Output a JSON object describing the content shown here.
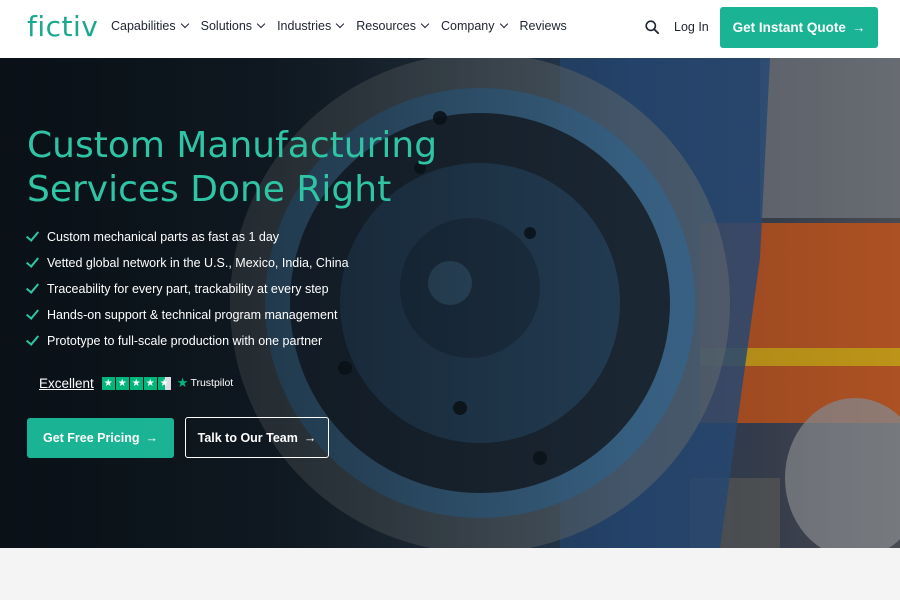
{
  "brand": {
    "logo_text": "fictiv",
    "accent_color": "#1ab394",
    "headline_color": "#2ec4a4"
  },
  "nav": {
    "items": [
      {
        "label": "Capabilities",
        "has_dropdown": true
      },
      {
        "label": "Solutions",
        "has_dropdown": true
      },
      {
        "label": "Industries",
        "has_dropdown": true
      },
      {
        "label": "Resources",
        "has_dropdown": true
      },
      {
        "label": "Company",
        "has_dropdown": true
      },
      {
        "label": "Reviews",
        "has_dropdown": false
      }
    ],
    "search_icon": "search-icon",
    "login_label": "Log In",
    "quote_label": "Get Instant Quote",
    "quote_arrow": "→"
  },
  "hero": {
    "headline_line1": "Custom Manufacturing",
    "headline_line2": "Services Done Right",
    "bullets": [
      "Custom mechanical parts as fast as 1 day",
      "Vetted global network in the U.S., Mexico, India, China",
      "Traceability for every part, trackability at every step",
      "Hands-on support & technical program management",
      "Prototype to full-scale production with one partner"
    ],
    "trust": {
      "rating_label": "Excellent",
      "stars": 4.5,
      "provider": "Trustpilot",
      "provider_star": "★"
    },
    "primary_cta": "Get Free Pricing",
    "secondary_cta": "Talk to Our Team",
    "cta_arrow": "→"
  }
}
